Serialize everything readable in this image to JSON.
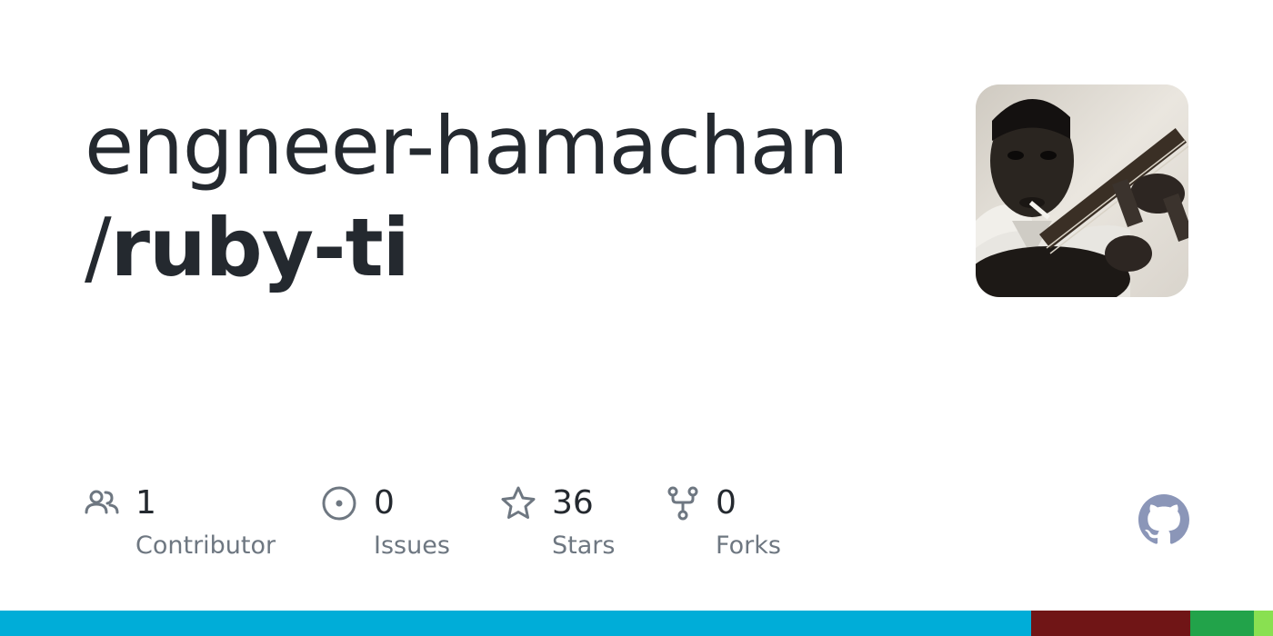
{
  "repo": {
    "owner": "engneer-hamachan",
    "separator": "/",
    "name": "ruby-ti"
  },
  "avatar": {
    "alt": "owner avatar"
  },
  "stats": [
    {
      "icon": "people-icon",
      "count": "1",
      "label": "Contributor"
    },
    {
      "icon": "issue-icon",
      "count": "0",
      "label": "Issues"
    },
    {
      "icon": "star-icon",
      "count": "36",
      "label": "Stars"
    },
    {
      "icon": "fork-icon",
      "count": "0",
      "label": "Forks"
    }
  ],
  "colors": {
    "text": "#24292f",
    "muted": "#6e7781",
    "icon": "#6e7781",
    "github_logo": "#8b96b8"
  },
  "languages": [
    {
      "color": "#00add8",
      "share": 0.81
    },
    {
      "color": "#701516",
      "share": 0.125
    },
    {
      "color": "#22a34a",
      "share": 0.05
    },
    {
      "color": "#89e051",
      "share": 0.015
    }
  ]
}
